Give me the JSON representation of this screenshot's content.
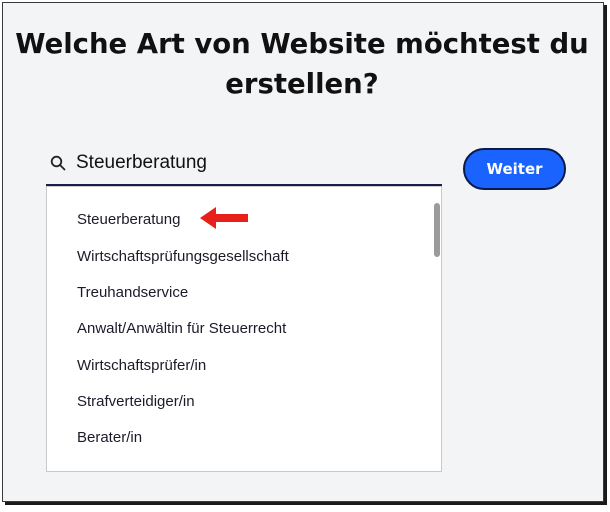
{
  "heading": {
    "line1": "Welche Art von Website möchtest du",
    "line2": "erstellen?"
  },
  "search": {
    "value": "Steuerberatung",
    "icon": "search-icon"
  },
  "continue_button": {
    "label": "Weiter",
    "color": "#1a63ff"
  },
  "dropdown": {
    "options": [
      "Steuerberatung",
      "Wirtschaftsprüfungsgesellschaft",
      "Treuhandservice",
      "Anwalt/Anwältin für Steuerrecht",
      "Wirtschaftsprüfer/in",
      "Strafverteidiger/in",
      "Berater/in"
    ]
  },
  "annotation": {
    "arrow_color": "#e8201a",
    "icon": "arrow-left-icon"
  }
}
